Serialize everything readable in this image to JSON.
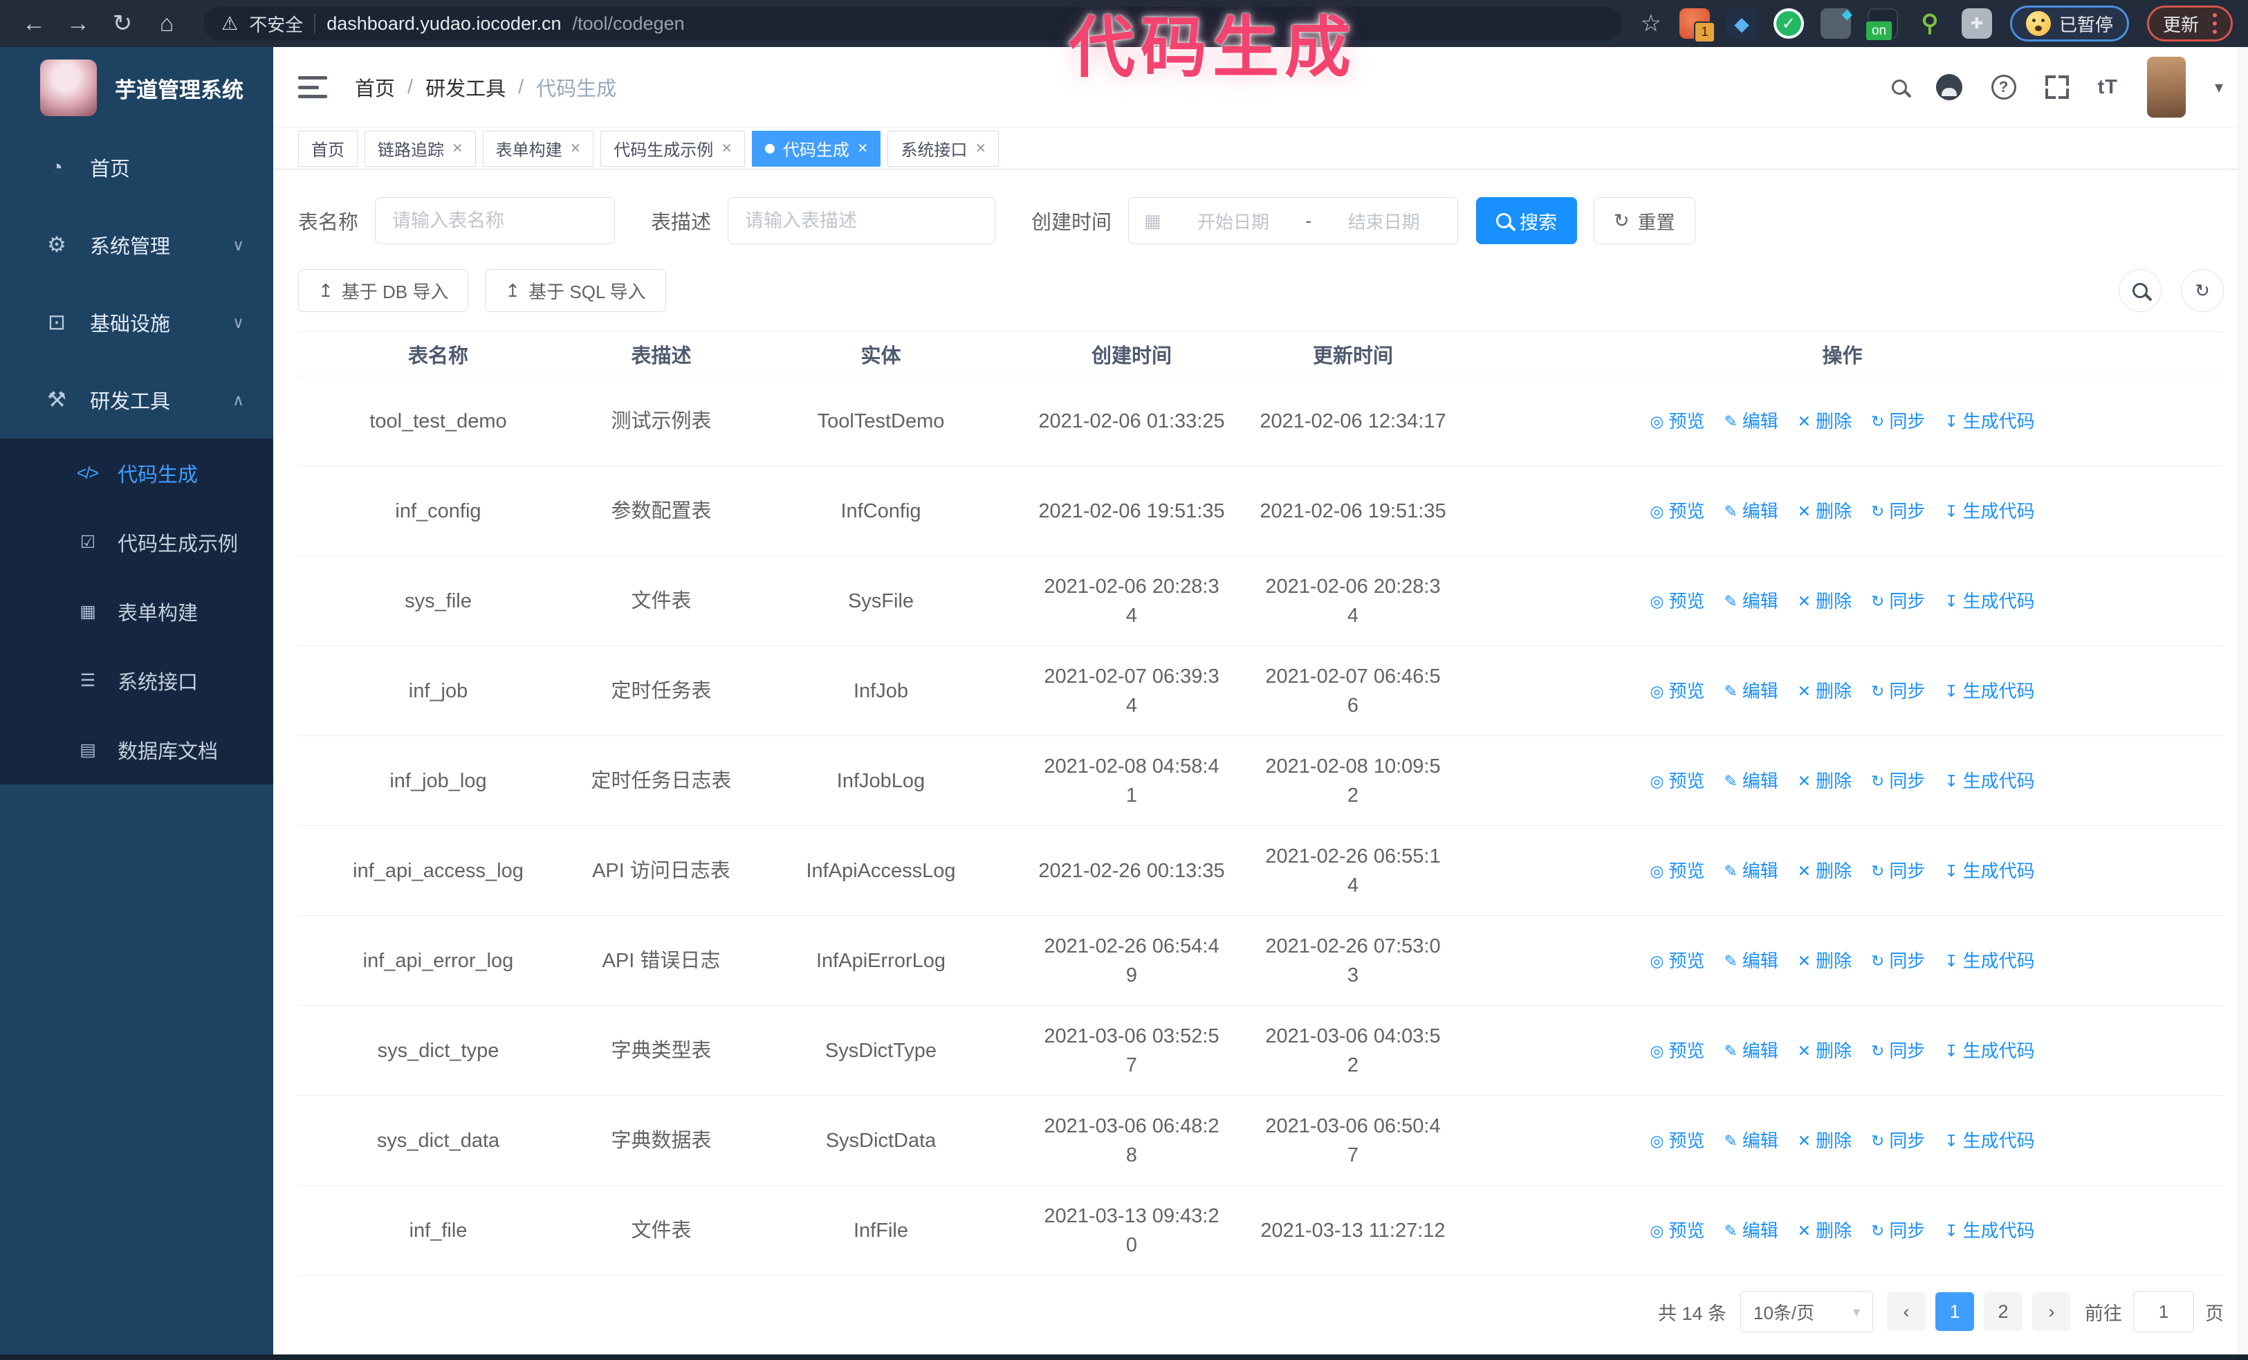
{
  "colors": {
    "accent": "#1890ff",
    "active_blue": "#409eff",
    "annotation_pink": "#f4436f",
    "sidebar_bg": "#1e4262",
    "submenu_bg": "#152740",
    "chrome_bg": "#222c3b"
  },
  "annotation": {
    "text": "代码生成"
  },
  "browser": {
    "insecure_label": "不安全",
    "url_host": "dashboard.yudao.iocoder.cn",
    "url_path": "/tool/codegen",
    "paused_label": "已暂停",
    "update_label": "更新",
    "extensions": [
      {
        "icon": "ext-orange-icon",
        "badge": "1"
      },
      {
        "icon": "ext-gem-icon",
        "badge": ""
      },
      {
        "icon": "ext-green-check-icon",
        "badge": ""
      },
      {
        "icon": "ext-gray-icon",
        "badge": ""
      },
      {
        "icon": "ext-dark-on-icon",
        "badge": "on"
      },
      {
        "icon": "ext-green-key-icon",
        "badge": ""
      },
      {
        "icon": "ext-puzzle-icon",
        "badge": ""
      }
    ]
  },
  "sidebar": {
    "app_title": "芋道管理系统",
    "items": [
      {
        "id": "home",
        "label": "首页",
        "icon": "dashboard-icon",
        "chevron": ""
      },
      {
        "id": "system",
        "label": "系统管理",
        "icon": "gear-icon",
        "chevron": "down"
      },
      {
        "id": "infra",
        "label": "基础设施",
        "icon": "infra-icon",
        "chevron": "down"
      },
      {
        "id": "dev-tools",
        "label": "研发工具",
        "icon": "tools-icon",
        "chevron": "up"
      }
    ],
    "submenu": [
      {
        "id": "codegen",
        "label": "代码生成",
        "icon": "code-icon",
        "active": true
      },
      {
        "id": "codegen-example",
        "label": "代码生成示例",
        "icon": "example-icon",
        "active": false
      },
      {
        "id": "form-builder",
        "label": "表单构建",
        "icon": "form-icon",
        "active": false
      },
      {
        "id": "api",
        "label": "系统接口",
        "icon": "api-icon",
        "active": false
      },
      {
        "id": "db-doc",
        "label": "数据库文档",
        "icon": "db-doc-icon",
        "active": false
      }
    ]
  },
  "header": {
    "breadcrumb": [
      "首页",
      "研发工具",
      "代码生成"
    ],
    "separator": "/",
    "font_icon_text": "tT"
  },
  "tabs": [
    {
      "id": "home",
      "label": "首页",
      "closable": false,
      "active": false
    },
    {
      "id": "tracer",
      "label": "链路追踪",
      "closable": true,
      "active": false
    },
    {
      "id": "form-builder",
      "label": "表单构建",
      "closable": true,
      "active": false
    },
    {
      "id": "codegen-example",
      "label": "代码生成示例",
      "closable": true,
      "active": false
    },
    {
      "id": "codegen",
      "label": "代码生成",
      "closable": true,
      "active": true
    },
    {
      "id": "api",
      "label": "系统接口",
      "closable": true,
      "active": false
    }
  ],
  "filters": {
    "table_name_label": "表名称",
    "table_name_placeholder": "请输入表名称",
    "table_desc_label": "表描述",
    "table_desc_placeholder": "请输入表描述",
    "create_time_label": "创建时间",
    "date_start_placeholder": "开始日期",
    "date_separator": "-",
    "date_end_placeholder": "结束日期",
    "search_label": "搜索",
    "reset_label": "重置"
  },
  "toolbar": {
    "import_db_label": "基于 DB 导入",
    "import_sql_label": "基于 SQL 导入"
  },
  "table": {
    "columns": [
      "表名称",
      "表描述",
      "实体",
      "创建时间",
      "更新时间",
      "操作"
    ],
    "actions": [
      {
        "label": "预览",
        "icon": "eye-icon"
      },
      {
        "label": "编辑",
        "icon": "edit-icon"
      },
      {
        "label": "删除",
        "icon": "trash-icon"
      },
      {
        "label": "同步",
        "icon": "sync-icon"
      },
      {
        "label": "生成代码",
        "icon": "download-icon"
      }
    ],
    "rows": [
      {
        "name": "tool_test_demo",
        "desc": "测试示例表",
        "entity": "ToolTestDemo",
        "created": "2021-02-06 01:33:25",
        "created_two_line": false,
        "updated": "2021-02-06 12:34:17",
        "updated_two_line": false
      },
      {
        "name": "inf_config",
        "desc": "参数配置表",
        "entity": "InfConfig",
        "created": "2021-02-06 19:51:35",
        "created_two_line": false,
        "updated": "2021-02-06 19:51:35",
        "updated_two_line": false
      },
      {
        "name": "sys_file",
        "desc": "文件表",
        "entity": "SysFile",
        "created": "2021-02-06 20:28:34",
        "created_two_line": true,
        "updated": "2021-02-06 20:28:34",
        "updated_two_line": true
      },
      {
        "name": "inf_job",
        "desc": "定时任务表",
        "entity": "InfJob",
        "created": "2021-02-07 06:39:34",
        "created_two_line": true,
        "updated": "2021-02-07 06:46:56",
        "updated_two_line": true
      },
      {
        "name": "inf_job_log",
        "desc": "定时任务日志表",
        "entity": "InfJobLog",
        "created": "2021-02-08 04:58:41",
        "created_two_line": true,
        "updated": "2021-02-08 10:09:52",
        "updated_two_line": true
      },
      {
        "name": "inf_api_access_log",
        "desc": "API 访问日志表",
        "entity": "InfApiAccessLog",
        "created": "2021-02-26 00:13:35",
        "created_two_line": false,
        "updated": "2021-02-26 06:55:14",
        "updated_two_line": true
      },
      {
        "name": "inf_api_error_log",
        "desc": "API 错误日志",
        "entity": "InfApiErrorLog",
        "created": "2021-02-26 06:54:49",
        "created_two_line": true,
        "updated": "2021-02-26 07:53:03",
        "updated_two_line": true
      },
      {
        "name": "sys_dict_type",
        "desc": "字典类型表",
        "entity": "SysDictType",
        "created": "2021-03-06 03:52:57",
        "created_two_line": true,
        "updated": "2021-03-06 04:03:52",
        "updated_two_line": true
      },
      {
        "name": "sys_dict_data",
        "desc": "字典数据表",
        "entity": "SysDictData",
        "created": "2021-03-06 06:48:28",
        "created_two_line": true,
        "updated": "2021-03-06 06:50:47",
        "updated_two_line": true
      },
      {
        "name": "inf_file",
        "desc": "文件表",
        "entity": "InfFile",
        "created": "2021-03-13 09:43:20",
        "created_two_line": true,
        "updated": "2021-03-13 11:27:12",
        "updated_two_line": false
      }
    ]
  },
  "pagination": {
    "total_label": "共 14 条",
    "page_size_label": "10条/页",
    "pages": [
      "1",
      "2"
    ],
    "active_page": "1",
    "goto_label": "前往",
    "goto_value": "1",
    "goto_suffix": "页"
  }
}
